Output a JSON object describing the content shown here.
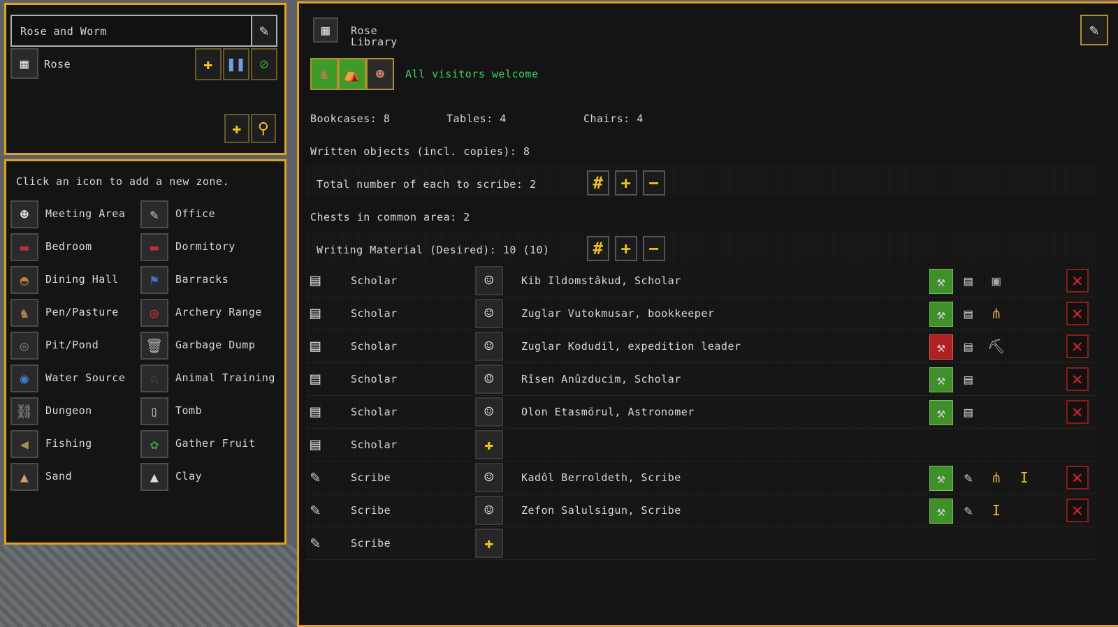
{
  "zone_panel": {
    "zone_name": "Rose and Worm",
    "location_name": "Rose"
  },
  "zone_list": {
    "instruction": "Click an icon to add a new zone.",
    "left": [
      "Meeting Area",
      "Bedroom",
      "Dining Hall",
      "Pen/Pasture",
      "Pit/Pond",
      "Water Source",
      "Dungeon",
      "Fishing",
      "Sand"
    ],
    "right": [
      "Office",
      "Dormitory",
      "Barracks",
      "Archery Range",
      "Garbage Dump",
      "Animal Training",
      "Tomb",
      "Gather Fruit",
      "Clay"
    ]
  },
  "location": {
    "title_line1": "Rose",
    "title_line2": "Library",
    "access_text": "All visitors welcome",
    "access_color": "#3cd060",
    "bookcases": "Bookcases: 8",
    "tables": "Tables: 4",
    "chairs": "Chairs: 4",
    "written": "Written objects (incl. copies): 8",
    "scribe_total": "Total number of each to scribe: 2",
    "chests": "Chests in common area: 2",
    "writing_material": "Writing Material (Desired): 10 (10)",
    "rows": [
      {
        "role": "Scholar",
        "occupant": "Kib Ildomstâkud, Scholar"
      },
      {
        "role": "Scholar",
        "occupant": "Zuglar Vutokmusar, bookkeeper"
      },
      {
        "role": "Scholar",
        "occupant": "Zuglar Kodudil, expedition leader"
      },
      {
        "role": "Scholar",
        "occupant": "Rîsen Anûzducim, Scholar"
      },
      {
        "role": "Scholar",
        "occupant": "Olon Etasmörul, Astronomer"
      },
      {
        "role": "Scholar",
        "occupant": ""
      },
      {
        "role": "Scribe",
        "occupant": "Kadôl Berroldeth, Scribe"
      },
      {
        "role": "Scribe",
        "occupant": "Zefon Salulsigun, Scribe"
      },
      {
        "role": "Scribe",
        "occupant": ""
      }
    ]
  },
  "colors": {
    "border": "#e0a020",
    "panel": "#141414",
    "text": "#d8d8d8",
    "accent_green": "#3cd060",
    "remove_red": "#e02020"
  },
  "icons": [
    "quill-icon",
    "bookcase-icon",
    "add-worker-icon",
    "pause-icon",
    "no-entry-icon",
    "add-squad-icon",
    "assign-icon",
    "hash-icon",
    "plus-icon",
    "minus-icon",
    "book-icon",
    "hammer-lock-icon",
    "wheat-icon",
    "pickaxe-icon",
    "cursor-icon",
    "remove-icon"
  ]
}
